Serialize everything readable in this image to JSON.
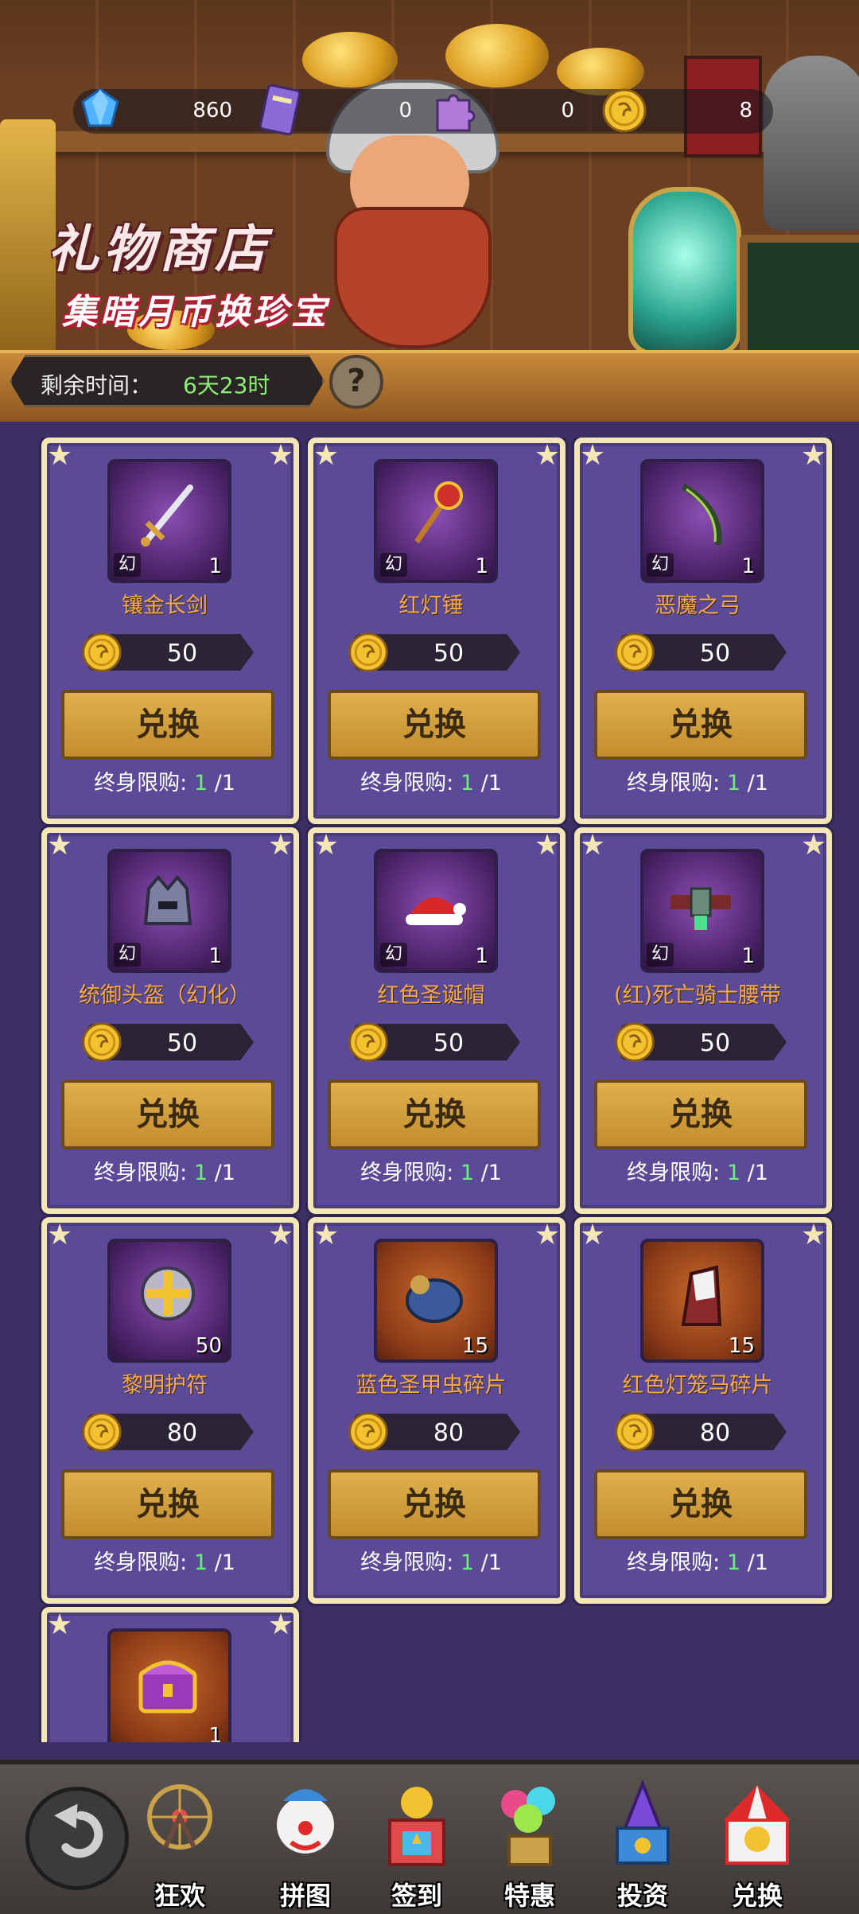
{
  "currency": {
    "gems": "860",
    "tickets": "0",
    "puzzles": "0",
    "coins": "8"
  },
  "header": {
    "title": "礼物商店",
    "subtitle": "集暗月币换珍宝",
    "timer_label": "剩余时间：",
    "timer_value": "6天23时",
    "help_icon": "?"
  },
  "shop": {
    "exchange_label": "兑换",
    "limit_prefix": "终身限购:",
    "items": [
      {
        "name": "镶金长剑",
        "tag": "幻",
        "qty": "1",
        "price": "50",
        "limit_used": "1",
        "limit_total": "/1",
        "icon": "sword-icon",
        "frame": "purple"
      },
      {
        "name": "红灯锤",
        "tag": "幻",
        "qty": "1",
        "price": "50",
        "limit_used": "1",
        "limit_total": "/1",
        "icon": "hammer-icon",
        "frame": "purple"
      },
      {
        "name": "恶魔之弓",
        "tag": "幻",
        "qty": "1",
        "price": "50",
        "limit_used": "1",
        "limit_total": "/1",
        "icon": "bow-icon",
        "frame": "purple"
      },
      {
        "name": "统御头盔（幻化）",
        "tag": "幻",
        "qty": "1",
        "price": "50",
        "limit_used": "1",
        "limit_total": "/1",
        "icon": "helmet-icon",
        "frame": "purple"
      },
      {
        "name": "红色圣诞帽",
        "tag": "幻",
        "qty": "1",
        "price": "50",
        "limit_used": "1",
        "limit_total": "/1",
        "icon": "santa-hat-icon",
        "frame": "purple"
      },
      {
        "name": "(红)死亡骑士腰带",
        "tag": "幻",
        "qty": "1",
        "price": "50",
        "limit_used": "1",
        "limit_total": "/1",
        "icon": "belt-icon",
        "frame": "purple"
      },
      {
        "name": "黎明护符",
        "tag": "",
        "qty": "50",
        "price": "80",
        "limit_used": "1",
        "limit_total": "/1",
        "icon": "amulet-icon",
        "frame": "purple"
      },
      {
        "name": "蓝色圣甲虫碎片",
        "tag": "",
        "qty": "15",
        "price": "80",
        "limit_used": "1",
        "limit_total": "/1",
        "icon": "scarab-mount-icon",
        "frame": "orange"
      },
      {
        "name": "红色灯笼马碎片",
        "tag": "",
        "qty": "15",
        "price": "80",
        "limit_used": "1",
        "limit_total": "/1",
        "icon": "lantern-horse-icon",
        "frame": "orange"
      },
      {
        "name": "",
        "tag": "",
        "qty": "1",
        "price": "",
        "limit_used": "",
        "limit_total": "",
        "icon": "treasure-chest-icon",
        "frame": "orange"
      }
    ]
  },
  "nav": {
    "items": [
      {
        "label": "狂欢",
        "icon": "ferris-wheel-icon"
      },
      {
        "label": "拼图",
        "icon": "clown-icon"
      },
      {
        "label": "签到",
        "icon": "jack-in-box-icon"
      },
      {
        "label": "特惠",
        "icon": "balloons-icon"
      },
      {
        "label": "投资",
        "icon": "magic-hat-icon"
      },
      {
        "label": "兑换",
        "icon": "circus-tent-icon"
      }
    ]
  },
  "colors": {
    "background": "#3b2f63",
    "card": "#5b4a97",
    "card_border": "#f4e7b5",
    "item_name": "#f7a94a",
    "limit_number": "#6cf07a",
    "timer_value": "#8ef07a",
    "button": "#d9a640"
  }
}
